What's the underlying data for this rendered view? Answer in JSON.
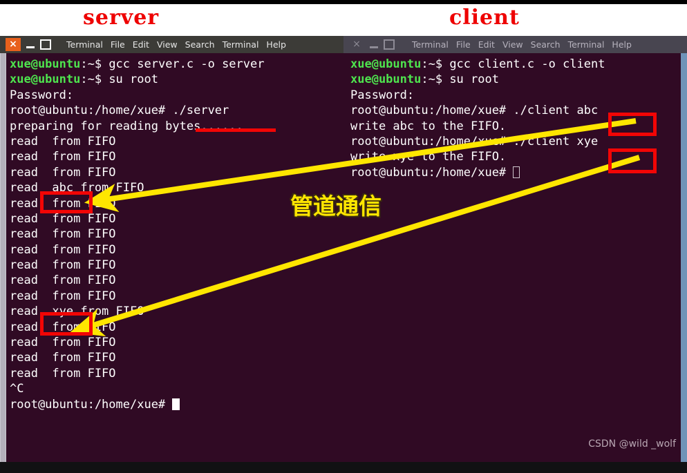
{
  "captions": {
    "server": "server",
    "client": "client"
  },
  "colors": {
    "caption": "#ee0000",
    "terminal_bg": "#300a24",
    "prompt_green": "#4ee44e",
    "annotation_red": "#f20505",
    "annotation_yellow": "#ffe600"
  },
  "window_controls": {
    "close": "×",
    "minimize": "minimize-icon",
    "maximize": "maximize-icon"
  },
  "menu_items": [
    "Terminal",
    "File",
    "Edit",
    "View",
    "Search",
    "Terminal",
    "Help"
  ],
  "terminals": {
    "left": {
      "title": "server",
      "active": true,
      "lines": [
        {
          "prompt": "xue@ubuntu",
          "sep": ":~$ ",
          "text": "gcc server.c -o server"
        },
        {
          "prompt": "xue@ubuntu",
          "sep": ":~$ ",
          "text": "su root"
        },
        {
          "prompt": "",
          "sep": "",
          "text": "Password:"
        },
        {
          "prompt": "",
          "sep": "",
          "text": "root@ubuntu:/home/xue# ./server"
        },
        {
          "prompt": "",
          "sep": "",
          "text": "preparing for reading bytes......"
        },
        {
          "prompt": "",
          "sep": "",
          "text": "read  from FIFO"
        },
        {
          "prompt": "",
          "sep": "",
          "text": "read  from FIFO"
        },
        {
          "prompt": "",
          "sep": "",
          "text": "read  from FIFO"
        },
        {
          "prompt": "",
          "sep": "",
          "text": "read  abc from FIFO"
        },
        {
          "prompt": "",
          "sep": "",
          "text": "read  from FIFO"
        },
        {
          "prompt": "",
          "sep": "",
          "text": "read  from FIFO"
        },
        {
          "prompt": "",
          "sep": "",
          "text": "read  from FIFO"
        },
        {
          "prompt": "",
          "sep": "",
          "text": "read  from FIFO"
        },
        {
          "prompt": "",
          "sep": "",
          "text": "read  from FIFO"
        },
        {
          "prompt": "",
          "sep": "",
          "text": "read  from FIFO"
        },
        {
          "prompt": "",
          "sep": "",
          "text": "read  from FIFO"
        },
        {
          "prompt": "",
          "sep": "",
          "text": "read  xye from FIFO"
        },
        {
          "prompt": "",
          "sep": "",
          "text": "read  from FIFO"
        },
        {
          "prompt": "",
          "sep": "",
          "text": "read  from FIFO"
        },
        {
          "prompt": "",
          "sep": "",
          "text": "read  from FIFO"
        },
        {
          "prompt": "",
          "sep": "",
          "text": "read  from FIFO"
        },
        {
          "prompt": "",
          "sep": "",
          "text": "^C"
        },
        {
          "prompt": "",
          "sep": "",
          "text": "root@ubuntu:/home/xue# ",
          "cursor": "block"
        }
      ]
    },
    "right": {
      "title": "client",
      "active": false,
      "lines": [
        {
          "prompt": "xue@ubuntu",
          "sep": ":~$ ",
          "text": "gcc client.c -o client"
        },
        {
          "prompt": "xue@ubuntu",
          "sep": ":~$ ",
          "text": "su root"
        },
        {
          "prompt": "",
          "sep": "",
          "text": "Password:"
        },
        {
          "prompt": "",
          "sep": "",
          "text": "root@ubuntu:/home/xue# ./client abc"
        },
        {
          "prompt": "",
          "sep": "",
          "text": "write abc to the FIFO."
        },
        {
          "prompt": "",
          "sep": "",
          "text": "root@ubuntu:/home/xue# ./client xye"
        },
        {
          "prompt": "",
          "sep": "",
          "text": "write xye to the FIFO."
        },
        {
          "prompt": "",
          "sep": "",
          "text": "root@ubuntu:/home/xue# ",
          "cursor": "hollow"
        }
      ]
    }
  },
  "annotations": {
    "chinese_label": "管道通信",
    "highlight_boxes": [
      {
        "name": "server-abc-box",
        "token": "abc"
      },
      {
        "name": "server-xye-box",
        "token": "xye"
      },
      {
        "name": "client-abc-box",
        "token": "abc"
      },
      {
        "name": "client-xye-box",
        "token": "xye"
      }
    ],
    "underline_target": "./server"
  },
  "watermark": "CSDN @wild _wolf"
}
